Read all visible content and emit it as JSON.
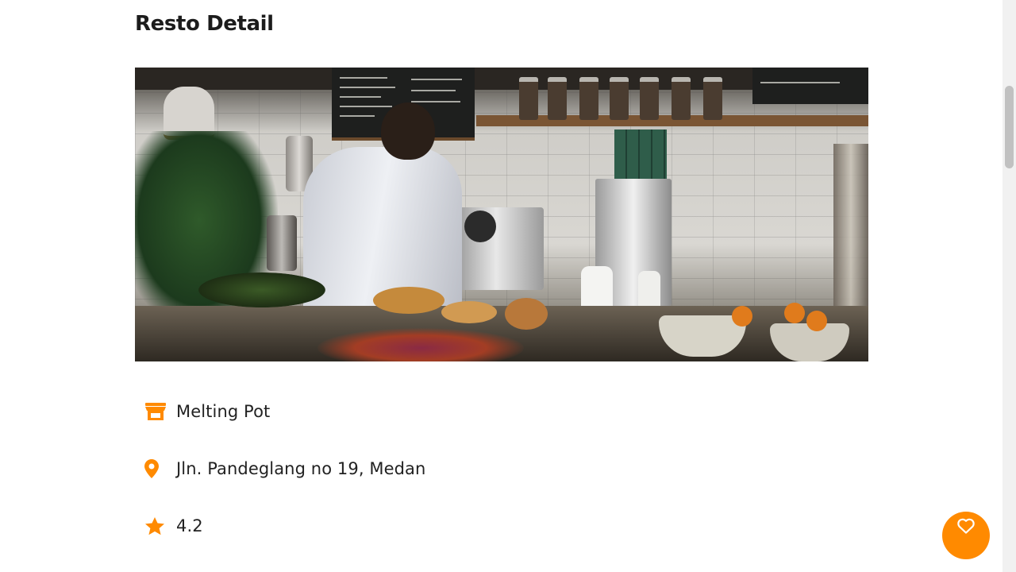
{
  "page": {
    "title": "Resto Detail"
  },
  "restaurant": {
    "image_alt": "Melting Pot",
    "name": "Melting Pot",
    "address": "Jln. Pandeglang no 19, Medan",
    "rating": "4.2"
  },
  "icons": {
    "name": "store-icon",
    "address": "map-pin-icon",
    "rating": "star-icon",
    "favorite": "heart-outline-icon"
  },
  "colors": {
    "accent": "#ff8a00",
    "text": "#222222",
    "title": "#1c1c1c",
    "background": "#ffffff"
  },
  "scroll": {
    "position_fraction": 0.15
  }
}
